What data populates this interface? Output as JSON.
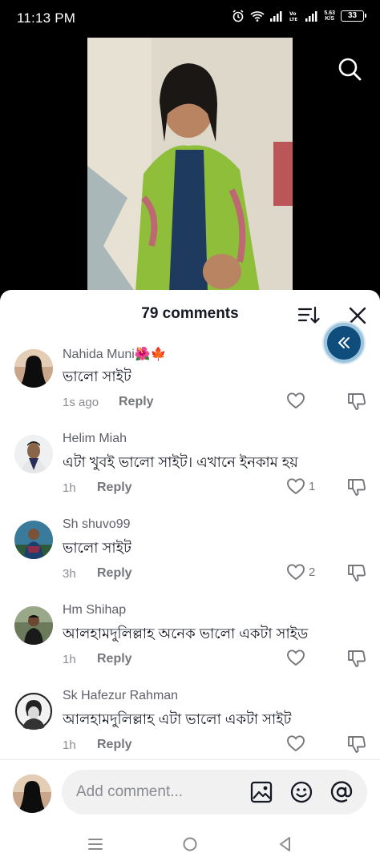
{
  "status_bar": {
    "time": "11:13 PM",
    "network_speed_value": "5.63",
    "network_speed_unit": "K/S",
    "battery_level": "33"
  },
  "sheet": {
    "comments_count": "79 comments"
  },
  "comments": [
    {
      "user": "Nahida Muni🌺🍁",
      "text": "ভালো সাইট",
      "time": "1s ago",
      "reply_label": "Reply",
      "likes": ""
    },
    {
      "user": "Helim Miah",
      "text": "এটা খুবই ভালো সাইট। এখানে ইনকাম হয়",
      "time": "1h",
      "reply_label": "Reply",
      "likes": "1"
    },
    {
      "user": "Sh shuvo99",
      "text": "ভালো সাইট",
      "time": "3h",
      "reply_label": "Reply",
      "likes": "2"
    },
    {
      "user": "Hm Shihap",
      "text": "আলহামদুলিল্লাহ অনেক ভালো একটা সাইড",
      "time": "1h",
      "reply_label": "Reply",
      "likes": ""
    },
    {
      "user": "Sk Hafezur Rahman",
      "text": "আলহামদুলিল্লাহ এটা ভালো একটা সাইট",
      "time": "1h",
      "reply_label": "Reply",
      "likes": ""
    }
  ],
  "compose": {
    "placeholder": "Add comment..."
  },
  "colors": {
    "accent_float": "#0f4d7c",
    "text_primary": "#161823",
    "text_secondary": "#75767c"
  },
  "icons": [
    "search-icon",
    "sort-icon",
    "close-icon",
    "collapse-icon",
    "heart-icon",
    "dislike-icon",
    "image-icon",
    "emoji-icon",
    "mention-icon",
    "menu-icon",
    "home-icon",
    "back-icon"
  ]
}
